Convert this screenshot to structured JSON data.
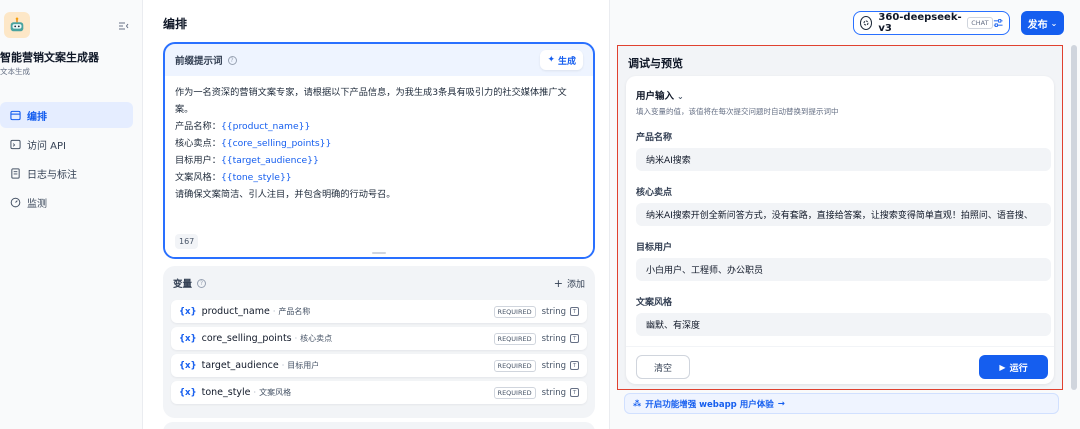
{
  "sidebar": {
    "app_name": "智能营销文案生成器",
    "app_type": "文本生成",
    "nav": [
      {
        "label": "编排",
        "icon": "layout-icon",
        "active": true
      },
      {
        "label": "访问 API",
        "icon": "terminal-icon",
        "active": false
      },
      {
        "label": "日志与标注",
        "icon": "file-list-icon",
        "active": false
      },
      {
        "label": "监测",
        "icon": "dashboard-icon",
        "active": false
      }
    ]
  },
  "header": {
    "title": "编排",
    "model_name": "360-deepseek-v3",
    "model_badge": "CHAT",
    "publish_label": "发布"
  },
  "prompt": {
    "title": "前缀提示词",
    "generate_label": "生成",
    "intro": "作为一名资深的营销文案专家，请根据以下产品信息，为我生成3条具有吸引力的社交媒体推广文",
    "intro_tail": "案。",
    "lines": [
      {
        "label": "产品名称：",
        "var": "{{product_name}}"
      },
      {
        "label": "核心卖点：",
        "var": "{{core_selling_points}}"
      },
      {
        "label": "目标用户：",
        "var": "{{target_audience}}"
      },
      {
        "label": "文案风格：",
        "var": "{{tone_style}}"
      }
    ],
    "outro": "请确保文案简洁、引人注目，并包含明确的行动号召。",
    "char_count": "167"
  },
  "variables": {
    "title": "变量",
    "add_label": "添加",
    "items": [
      {
        "key": "product_name",
        "label": "产品名称",
        "required": "REQUIRED",
        "type": "string"
      },
      {
        "key": "core_selling_points",
        "label": "核心卖点",
        "required": "REQUIRED",
        "type": "string"
      },
      {
        "key": "target_audience",
        "label": "目标用户",
        "required": "REQUIRED",
        "type": "string"
      },
      {
        "key": "tone_style",
        "label": "文案风格",
        "required": "REQUIRED",
        "type": "string"
      }
    ]
  },
  "preview": {
    "title": "调试与预览",
    "input_title": "用户输入",
    "input_desc": "填入变量的值，该值将在每次提交问题时自动替换到提示词中",
    "fields": [
      {
        "label": "产品名称",
        "value": "纳米AI搜索"
      },
      {
        "label": "核心卖点",
        "value": "纳米AI搜索开创全新问答方式，没有套路，直接给答案，让搜索变得简单直观！拍照问、语音搜、"
      },
      {
        "label": "目标用户",
        "value": "小白用户、工程师、办公职员"
      },
      {
        "label": "文案风格",
        "value": "幽默、有深度"
      }
    ],
    "clear_label": "清空",
    "run_label": "运行",
    "enhance_label": "开启功能增强 webapp 用户体验"
  },
  "colors": {
    "accent": "#155eef",
    "highlight_frame": "#e0412f"
  }
}
